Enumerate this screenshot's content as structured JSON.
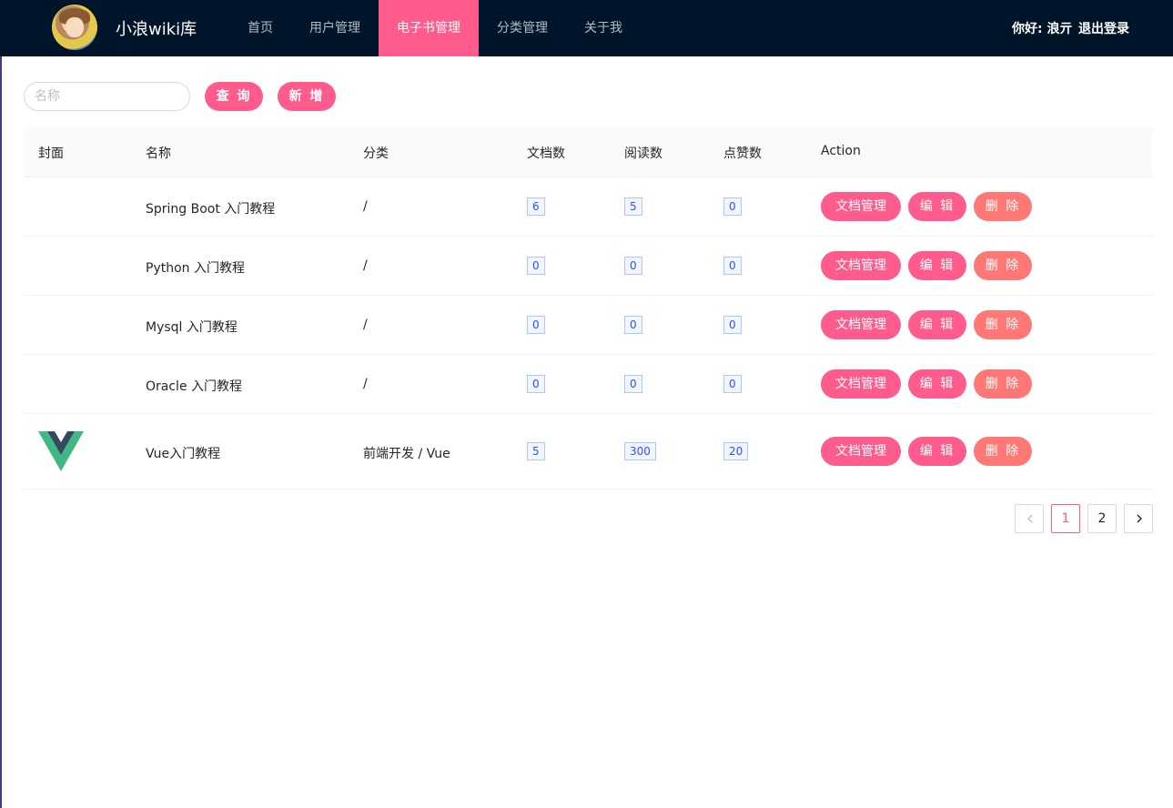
{
  "header": {
    "brand": "小浪wiki库",
    "nav": [
      "首页",
      "用户管理",
      "电子书管理",
      "分类管理",
      "关于我"
    ],
    "active_nav": "电子书管理",
    "greeting": "你好: 浪亓",
    "logout": "退出登录"
  },
  "toolbar": {
    "search_placeholder": "名称",
    "query_label": "查 询",
    "add_label": "新 增"
  },
  "table": {
    "headers": [
      "封面",
      "名称",
      "分类",
      "文档数",
      "阅读数",
      "点赞数",
      "Action"
    ],
    "rows": [
      {
        "name": "Spring Boot 入门教程",
        "category": "/",
        "docs": "6",
        "views": "5",
        "likes": "0",
        "cover": ""
      },
      {
        "name": "Python 入门教程",
        "category": "/",
        "docs": "0",
        "views": "0",
        "likes": "0",
        "cover": ""
      },
      {
        "name": "Mysql 入门教程",
        "category": "/",
        "docs": "0",
        "views": "0",
        "likes": "0",
        "cover": ""
      },
      {
        "name": "Oracle 入门教程",
        "category": "/",
        "docs": "0",
        "views": "0",
        "likes": "0",
        "cover": ""
      },
      {
        "name": "Vue入门教程",
        "category": "前端开发 / Vue",
        "docs": "5",
        "views": "300",
        "likes": "20",
        "cover": "vue-logo-icon"
      }
    ],
    "actions": {
      "doc": "文档管理",
      "edit": "编 辑",
      "delete": "删 除"
    }
  },
  "pagination": {
    "pages": [
      "1",
      "2"
    ],
    "current": "1"
  },
  "colors": {
    "header_bg": "#001529",
    "accent": "#ff5c8d",
    "danger": "#ff7875",
    "tag_border": "#adc6ff",
    "tag_text": "#2f54eb"
  }
}
